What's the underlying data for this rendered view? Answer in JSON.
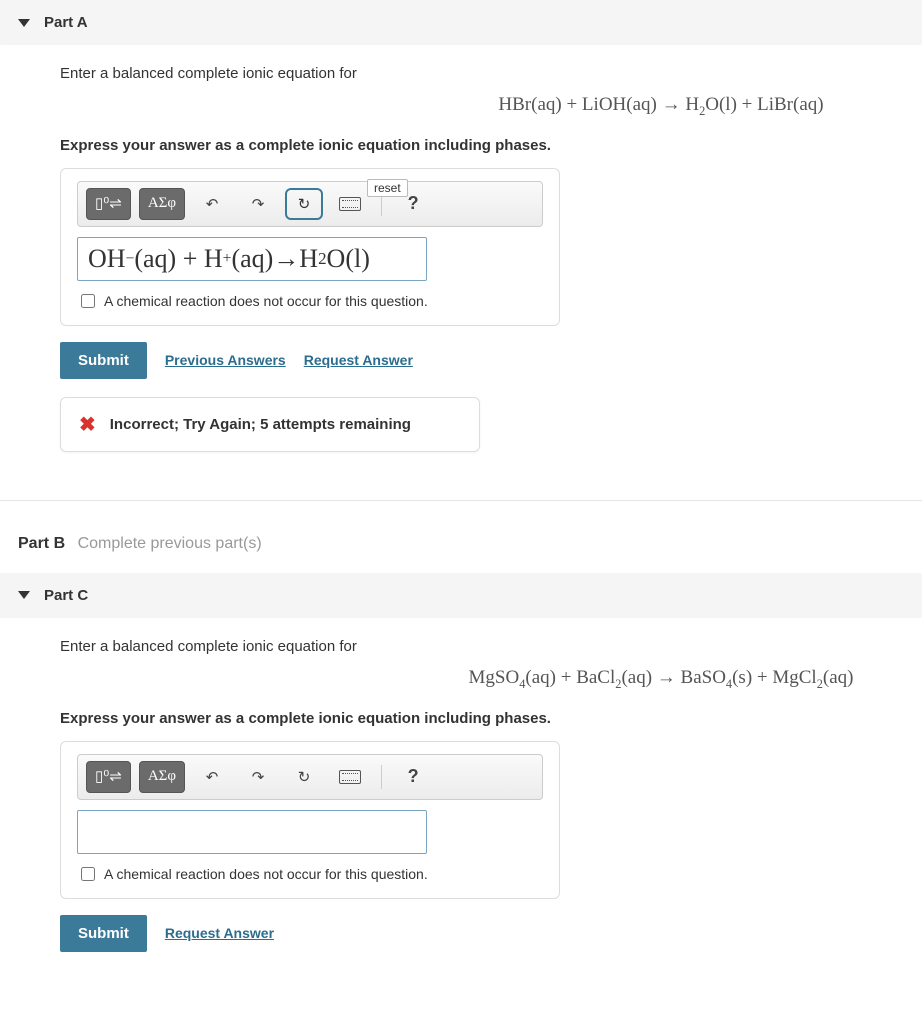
{
  "partA": {
    "title": "Part A",
    "prompt": "Enter a balanced complete ionic equation for",
    "equation_html": "HBr(aq) + LiOH(aq) → H<sub>2</sub>O(l) + LiBr(aq)",
    "instruction": "Express your answer as a complete ionic equation including phases.",
    "toolbar": {
      "template_btn": "▯⁰⇌",
      "greek_btn": "ΑΣφ",
      "undo": "↶",
      "redo": "↷",
      "reset": "↻",
      "reset_tooltip": "reset",
      "help": "?"
    },
    "answer_html": "OH<sup>−</sup> (aq) + H<sup>+</sup> (aq)→H<sub>2</sub> O(l)",
    "no_reaction_label": "A chemical reaction does not occur for this question.",
    "submit": "Submit",
    "previous_answers": "Previous Answers",
    "request_answer": "Request Answer",
    "feedback": "Incorrect; Try Again; 5 attempts remaining"
  },
  "partB": {
    "title": "Part B",
    "subtitle": "Complete previous part(s)"
  },
  "partC": {
    "title": "Part C",
    "prompt": "Enter a balanced complete ionic equation for",
    "equation_html": "MgSO<sub>4</sub>(aq) + BaCl<sub>2</sub>(aq) → BaSO<sub>4</sub>(s) + MgCl<sub>2</sub>(aq)",
    "instruction": "Express your answer as a complete ionic equation including phases.",
    "toolbar": {
      "template_btn": "▯⁰⇌",
      "greek_btn": "ΑΣφ",
      "undo": "↶",
      "redo": "↷",
      "reset": "↻",
      "help": "?"
    },
    "answer_html": "",
    "no_reaction_label": "A chemical reaction does not occur for this question.",
    "submit": "Submit",
    "request_answer": "Request Answer"
  }
}
